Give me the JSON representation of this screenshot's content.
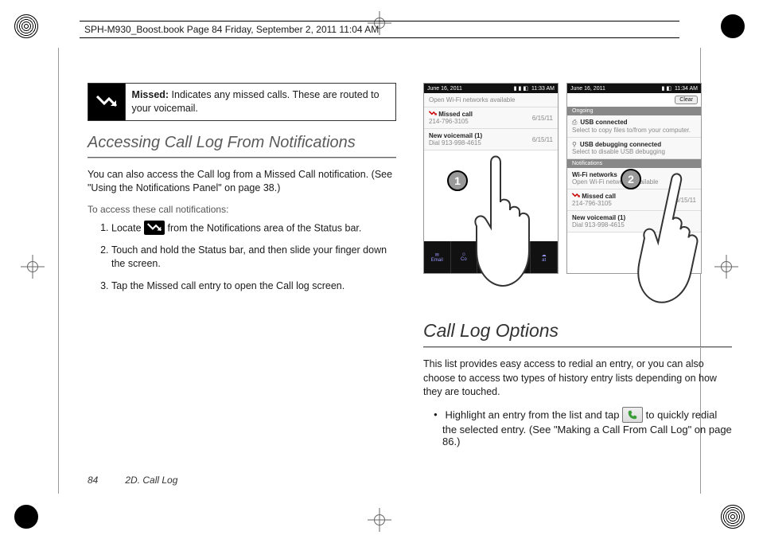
{
  "header_line": "SPH-M930_Boost.book  Page 84  Friday, September 2, 2011  11:04 AM",
  "callout": {
    "label": "Missed:",
    "text": " Indicates any missed calls. These are routed to your voicemail."
  },
  "left": {
    "h1": "Accessing Call Log From Notifications",
    "p1": "You can also access the Call log from a Missed Call notification. (See \"Using the Notifications Panel\" on page 38.)",
    "lead": "To access these call notifications:",
    "steps": {
      "s1a": "Locate ",
      "s1b": " from the Notifications area of the Status bar.",
      "s2": "Touch and hold the Status bar, and then slide your finger down the screen.",
      "s3": "Tap the Missed call entry to open the Call log screen."
    }
  },
  "right": {
    "h1": "Call Log Options",
    "p1": "This list provides easy access to redial an entry, or you can also choose to access two types of history entry lists depending on how they are touched.",
    "bullet1a": "Highlight an entry from the list and tap ",
    "bullet1b": " to quickly redial the selected entry. (See \"Making a Call From Call Log\" on page 86.)"
  },
  "illus": {
    "badge1": "1",
    "badge2": "2",
    "phone1": {
      "date": "June 16, 2011",
      "time": "11:33 AM",
      "wifi_line": "Open Wi-Fi networks available",
      "missed_label": "Missed call",
      "missed_num": "214-796-3105",
      "missed_date": "6/15/11",
      "vm_label": "New voicemail (1)",
      "vm_sub": "Dial 913-998-4615",
      "vm_date": "6/15/11",
      "dock": [
        "Email",
        "Co",
        "",
        "",
        "at"
      ]
    },
    "phone2": {
      "date": "June 16, 2011",
      "time": "11:34 AM",
      "clear": "Clear",
      "ongoing": "Ongoing",
      "usb1_t": "USB connected",
      "usb1_s": "Select to copy files to/from your computer.",
      "usb2_t": "USB debugging connected",
      "usb2_s": "Select to disable USB debugging",
      "notif_section": "Notifications",
      "wifi_t": "Wi-Fi networks",
      "wifi_s": "Open Wi-Fi networks available",
      "missed_label": "Missed call",
      "missed_num": "214-796-3105",
      "missed_date": "6/15/11",
      "vm_label": "New voicemail (1)",
      "vm_sub": "Dial 913-998-4615"
    }
  },
  "footer": {
    "page": "84",
    "section": "2D. Call Log"
  }
}
